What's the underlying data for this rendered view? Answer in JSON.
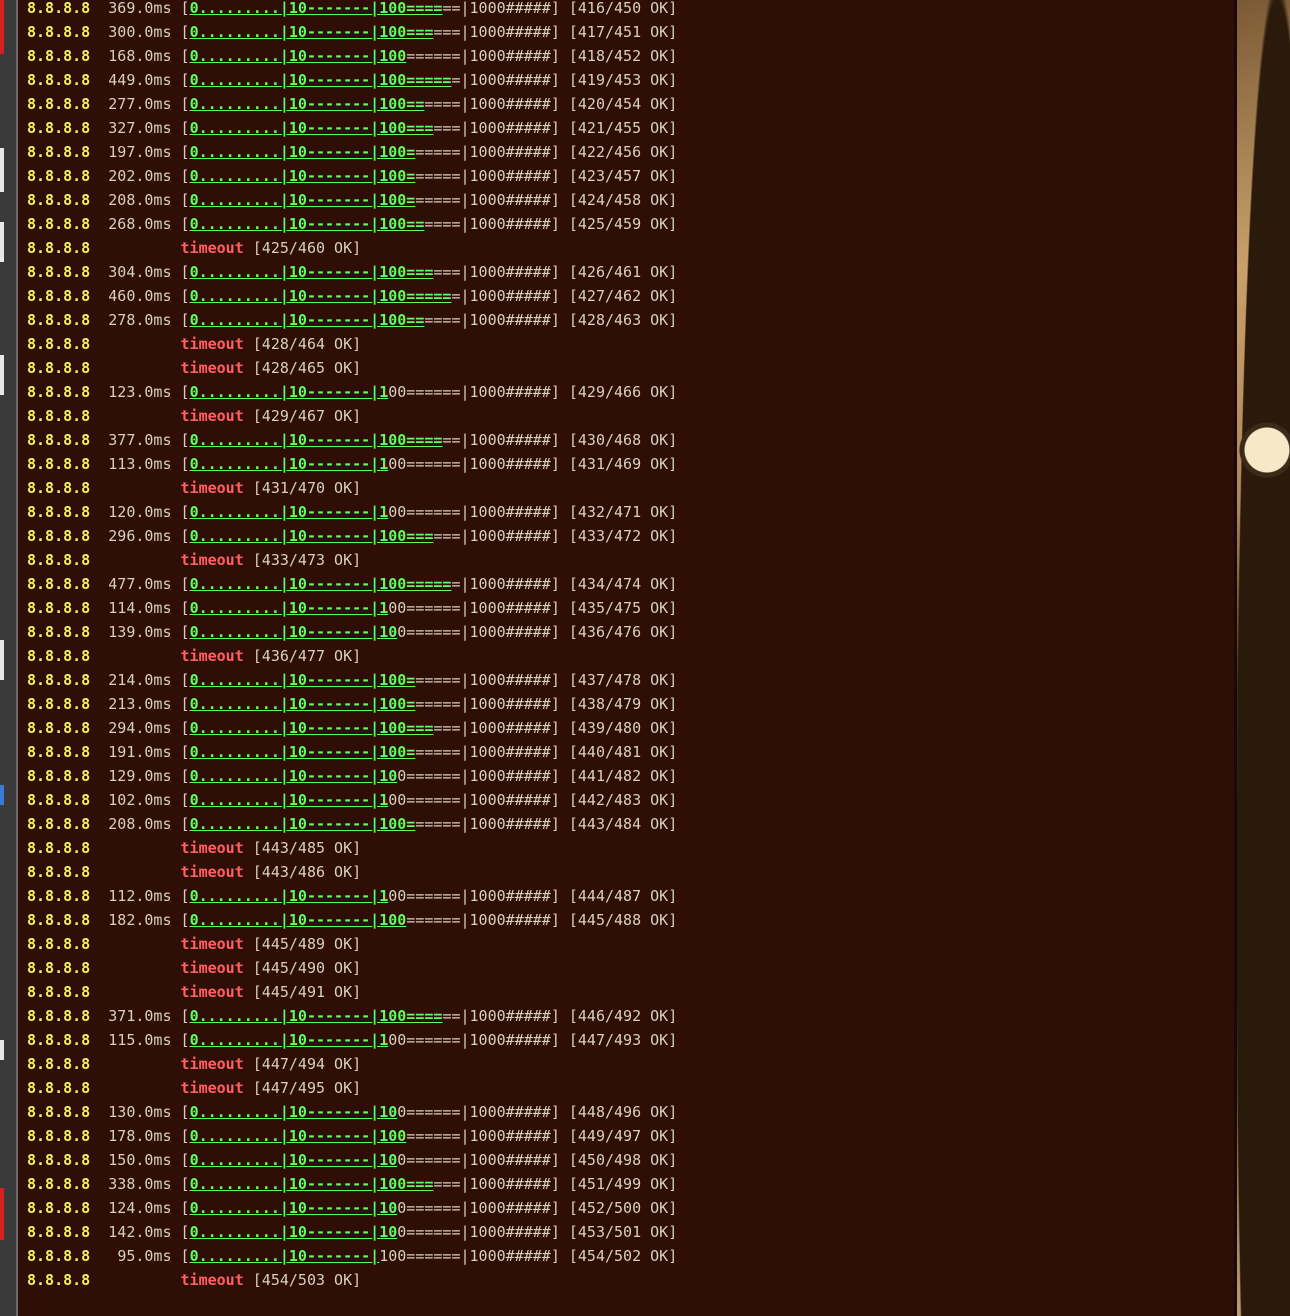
{
  "terminal": {
    "colors": {
      "background": "#2e0e07",
      "host": "#f2f25a",
      "bar_fill": "#5fff5f",
      "timeout": "#ff5f5f",
      "text": "#d8d0c0"
    },
    "bar_template": "0.........|10-------|100======|1000#####",
    "lines": [
      {
        "host": "8.8.8.8",
        "latency": "369.0ms",
        "status": "[416/450 OK]",
        "timeout": false
      },
      {
        "host": "8.8.8.8",
        "latency": "300.0ms",
        "status": "[417/451 OK]",
        "timeout": false
      },
      {
        "host": "8.8.8.8",
        "latency": "168.0ms",
        "status": "[418/452 OK]",
        "timeout": false
      },
      {
        "host": "8.8.8.8",
        "latency": "449.0ms",
        "status": "[419/453 OK]",
        "timeout": false
      },
      {
        "host": "8.8.8.8",
        "latency": "277.0ms",
        "status": "[420/454 OK]",
        "timeout": false
      },
      {
        "host": "8.8.8.8",
        "latency": "327.0ms",
        "status": "[421/455 OK]",
        "timeout": false
      },
      {
        "host": "8.8.8.8",
        "latency": "197.0ms",
        "status": "[422/456 OK]",
        "timeout": false
      },
      {
        "host": "8.8.8.8",
        "latency": "202.0ms",
        "status": "[423/457 OK]",
        "timeout": false
      },
      {
        "host": "8.8.8.8",
        "latency": "208.0ms",
        "status": "[424/458 OK]",
        "timeout": false
      },
      {
        "host": "8.8.8.8",
        "latency": "268.0ms",
        "status": "[425/459 OK]",
        "timeout": false
      },
      {
        "host": "8.8.8.8",
        "latency": "",
        "status": "[425/460 OK]",
        "timeout": true
      },
      {
        "host": "8.8.8.8",
        "latency": "304.0ms",
        "status": "[426/461 OK]",
        "timeout": false
      },
      {
        "host": "8.8.8.8",
        "latency": "460.0ms",
        "status": "[427/462 OK]",
        "timeout": false
      },
      {
        "host": "8.8.8.8",
        "latency": "278.0ms",
        "status": "[428/463 OK]",
        "timeout": false
      },
      {
        "host": "8.8.8.8",
        "latency": "",
        "status": "[428/464 OK]",
        "timeout": true
      },
      {
        "host": "8.8.8.8",
        "latency": "",
        "status": "[428/465 OK]",
        "timeout": true
      },
      {
        "host": "8.8.8.8",
        "latency": "123.0ms",
        "status": "[429/466 OK]",
        "timeout": false
      },
      {
        "host": "8.8.8.8",
        "latency": "",
        "status": "[429/467 OK]",
        "timeout": true
      },
      {
        "host": "8.8.8.8",
        "latency": "377.0ms",
        "status": "[430/468 OK]",
        "timeout": false
      },
      {
        "host": "8.8.8.8",
        "latency": "113.0ms",
        "status": "[431/469 OK]",
        "timeout": false
      },
      {
        "host": "8.8.8.8",
        "latency": "",
        "status": "[431/470 OK]",
        "timeout": true
      },
      {
        "host": "8.8.8.8",
        "latency": "120.0ms",
        "status": "[432/471 OK]",
        "timeout": false
      },
      {
        "host": "8.8.8.8",
        "latency": "296.0ms",
        "status": "[433/472 OK]",
        "timeout": false
      },
      {
        "host": "8.8.8.8",
        "latency": "",
        "status": "[433/473 OK]",
        "timeout": true
      },
      {
        "host": "8.8.8.8",
        "latency": "477.0ms",
        "status": "[434/474 OK]",
        "timeout": false
      },
      {
        "host": "8.8.8.8",
        "latency": "114.0ms",
        "status": "[435/475 OK]",
        "timeout": false
      },
      {
        "host": "8.8.8.8",
        "latency": "139.0ms",
        "status": "[436/476 OK]",
        "timeout": false
      },
      {
        "host": "8.8.8.8",
        "latency": "",
        "status": "[436/477 OK]",
        "timeout": true
      },
      {
        "host": "8.8.8.8",
        "latency": "214.0ms",
        "status": "[437/478 OK]",
        "timeout": false
      },
      {
        "host": "8.8.8.8",
        "latency": "213.0ms",
        "status": "[438/479 OK]",
        "timeout": false
      },
      {
        "host": "8.8.8.8",
        "latency": "294.0ms",
        "status": "[439/480 OK]",
        "timeout": false
      },
      {
        "host": "8.8.8.8",
        "latency": "191.0ms",
        "status": "[440/481 OK]",
        "timeout": false
      },
      {
        "host": "8.8.8.8",
        "latency": "129.0ms",
        "status": "[441/482 OK]",
        "timeout": false
      },
      {
        "host": "8.8.8.8",
        "latency": "102.0ms",
        "status": "[442/483 OK]",
        "timeout": false
      },
      {
        "host": "8.8.8.8",
        "latency": "208.0ms",
        "status": "[443/484 OK]",
        "timeout": false
      },
      {
        "host": "8.8.8.8",
        "latency": "",
        "status": "[443/485 OK]",
        "timeout": true
      },
      {
        "host": "8.8.8.8",
        "latency": "",
        "status": "[443/486 OK]",
        "timeout": true
      },
      {
        "host": "8.8.8.8",
        "latency": "112.0ms",
        "status": "[444/487 OK]",
        "timeout": false
      },
      {
        "host": "8.8.8.8",
        "latency": "182.0ms",
        "status": "[445/488 OK]",
        "timeout": false
      },
      {
        "host": "8.8.8.8",
        "latency": "",
        "status": "[445/489 OK]",
        "timeout": true
      },
      {
        "host": "8.8.8.8",
        "latency": "",
        "status": "[445/490 OK]",
        "timeout": true
      },
      {
        "host": "8.8.8.8",
        "latency": "",
        "status": "[445/491 OK]",
        "timeout": true
      },
      {
        "host": "8.8.8.8",
        "latency": "371.0ms",
        "status": "[446/492 OK]",
        "timeout": false
      },
      {
        "host": "8.8.8.8",
        "latency": "115.0ms",
        "status": "[447/493 OK]",
        "timeout": false
      },
      {
        "host": "8.8.8.8",
        "latency": "",
        "status": "[447/494 OK]",
        "timeout": true
      },
      {
        "host": "8.8.8.8",
        "latency": "",
        "status": "[447/495 OK]",
        "timeout": true
      },
      {
        "host": "8.8.8.8",
        "latency": "130.0ms",
        "status": "[448/496 OK]",
        "timeout": false
      },
      {
        "host": "8.8.8.8",
        "latency": "178.0ms",
        "status": "[449/497 OK]",
        "timeout": false
      },
      {
        "host": "8.8.8.8",
        "latency": "150.0ms",
        "status": "[450/498 OK]",
        "timeout": false
      },
      {
        "host": "8.8.8.8",
        "latency": "338.0ms",
        "status": "[451/499 OK]",
        "timeout": false
      },
      {
        "host": "8.8.8.8",
        "latency": "124.0ms",
        "status": "[452/500 OK]",
        "timeout": false
      },
      {
        "host": "8.8.8.8",
        "latency": "142.0ms",
        "status": "[453/501 OK]",
        "timeout": false
      },
      {
        "host": "8.8.8.8",
        "latency": "95.0ms",
        "status": "[454/502 OK]",
        "timeout": false
      },
      {
        "host": "8.8.8.8",
        "latency": "",
        "status": "[454/503 OK]",
        "timeout": true
      }
    ]
  }
}
